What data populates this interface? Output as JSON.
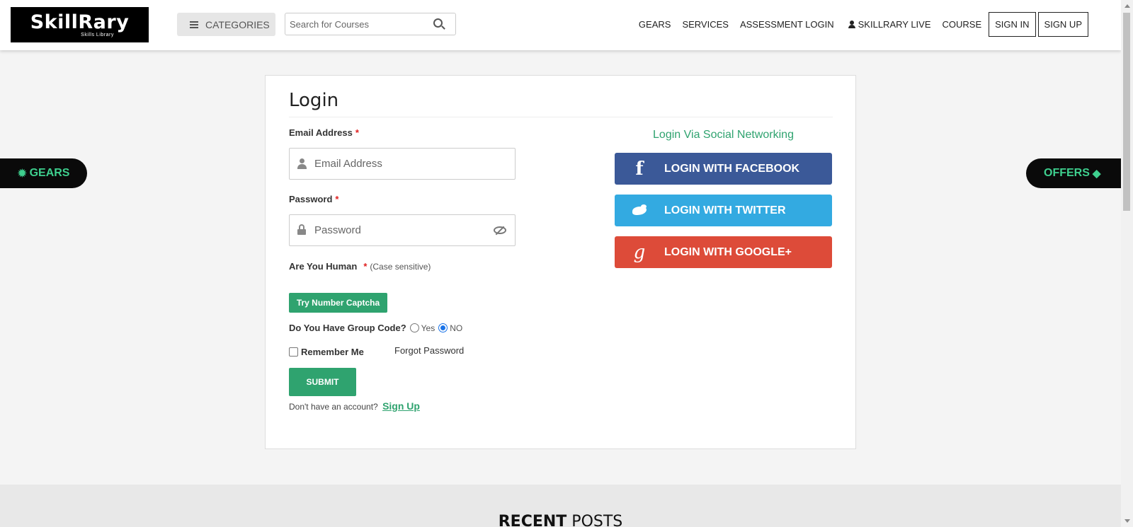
{
  "header": {
    "logo_main": "SkillRary",
    "logo_sub": "Skills Library",
    "categories_label": "CATEGORIES",
    "search_placeholder": "Search for Courses",
    "nav": {
      "gears": "GEARS",
      "services": "SERVICES",
      "assessment": "ASSESSMENT LOGIN",
      "live": "SKILLRARY LIVE",
      "course": "COURSE",
      "signin": "SIGN IN",
      "signup": "SIGN UP"
    }
  },
  "side": {
    "gears": "GEARS",
    "offers": "OFFERS"
  },
  "login": {
    "title": "Login",
    "email_label": "Email Address",
    "email_placeholder": "Email Address",
    "password_label": "Password",
    "password_placeholder": "Password",
    "required_mark": "*",
    "human_label": "Are You Human",
    "case_note": "(Case sensitive)",
    "captcha_button": "Try Number Captcha",
    "group_code_label": "Do You Have Group Code?",
    "group_yes": "Yes",
    "group_no": "NO",
    "group_selected": "NO",
    "remember_label": "Remember Me",
    "forgot_label": "Forgot Password",
    "submit_label": "SUBMIT",
    "no_account_text": "Don't have an account?",
    "signup_link": "Sign Up"
  },
  "social": {
    "title": "Login Via Social Networking",
    "facebook": "LOGIN WITH FACEBOOK",
    "twitter": "LOGIN WITH TWITTER",
    "google": "LOGIN WITH GOOGLE+",
    "facebook_color": "#3b5998",
    "twitter_color": "#33aae1",
    "google_color": "#dd4b39"
  },
  "recent": {
    "bold": "RECENT",
    "rest": "POSTS"
  },
  "colors": {
    "accent": "#2fa36f",
    "side_text": "#3ecf8e"
  }
}
